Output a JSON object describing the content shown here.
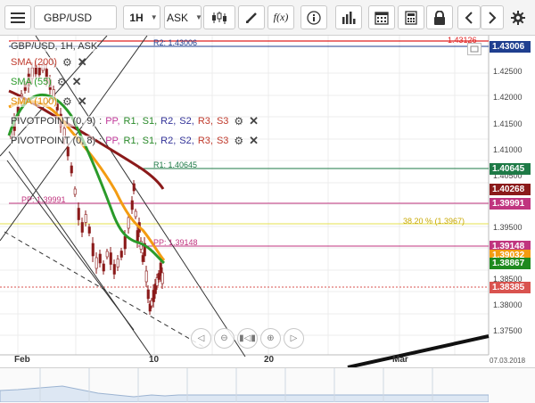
{
  "toolbar": {
    "symbol": "GBP/USD",
    "interval": "1H",
    "price_side": "ASK",
    "fx_label": "f(x)",
    "icons": [
      "menu-icon",
      "candlestick-icon",
      "draw-pencil-icon",
      "indicator-fx-icon",
      "info-icon",
      "bar-chart-icon",
      "calendar-icon",
      "calculator-icon",
      "lock-icon",
      "arrow-left-icon",
      "arrow-right-icon",
      "settings-icon"
    ]
  },
  "legend": {
    "title": "GBP/USD, 1H, ASK",
    "sma200": "SMA (200)",
    "sma55": "SMA (55)",
    "sma100": "SMA (100)",
    "pivot1": "PIVOTPOINT (0, 9)",
    "pivot2": "PIVOTPOINT (0, 8)",
    "pivot_parts": [
      ":",
      "PP,",
      "R1,",
      "S1,",
      "R2,",
      "S2,",
      "R3,",
      "S3"
    ],
    "pivot_part_colors": [
      "#555555",
      "#c0399a",
      "#2a8a2a",
      "#2a8a2a",
      "#333399",
      "#333399",
      "#c0392b",
      "#c0392b"
    ]
  },
  "price_axis": {
    "ticks": [
      "1.42500",
      "1.42000",
      "1.41500",
      "1.41000",
      "1.40500",
      "1.39500",
      "1.38500",
      "1.38000",
      "1.37500"
    ],
    "tags": [
      {
        "label": "1.43006",
        "color": "#1f3f8f"
      },
      {
        "label": "1.40645",
        "color": "#1e7a46"
      },
      {
        "label": "1.40268",
        "color": "#8b1a1a"
      },
      {
        "label": "1.39991",
        "color": "#c0357f"
      },
      {
        "label": "1.39148",
        "color": "#c0357f"
      },
      {
        "label": "1.39032",
        "color": "#f39c12"
      },
      {
        "label": "1.38867",
        "color": "#1e8a1e"
      },
      {
        "label": "1.38385",
        "color": "#d9534f"
      }
    ]
  },
  "levels": {
    "r2": "R2: 1.43006",
    "top_red": "1.43126",
    "r1": "R1: 1.40645",
    "pp1": "PP: 1.39991",
    "fib": "38.20 % (1.3967)",
    "pp2": "PP: 1.39148"
  },
  "time_axis": {
    "labels": [
      "Feb",
      "10",
      "20",
      "Mar"
    ],
    "date_readout": "07.03.2018"
  },
  "colors": {
    "sma200": "#8b1a1a",
    "sma55": "#2a9a2a",
    "sma100": "#f39c12",
    "candle": "#8b1a1a",
    "pp": "#c0357f",
    "r1": "#1e7a46",
    "r2": "#1f3f8f",
    "fib": "#e6e14d",
    "red": "#e02020"
  },
  "navigator": {
    "buttons": [
      "scroll-left-icon",
      "zoom-out-icon",
      "reset-zoom-icon",
      "zoom-in-icon",
      "scroll-right-icon"
    ]
  }
}
